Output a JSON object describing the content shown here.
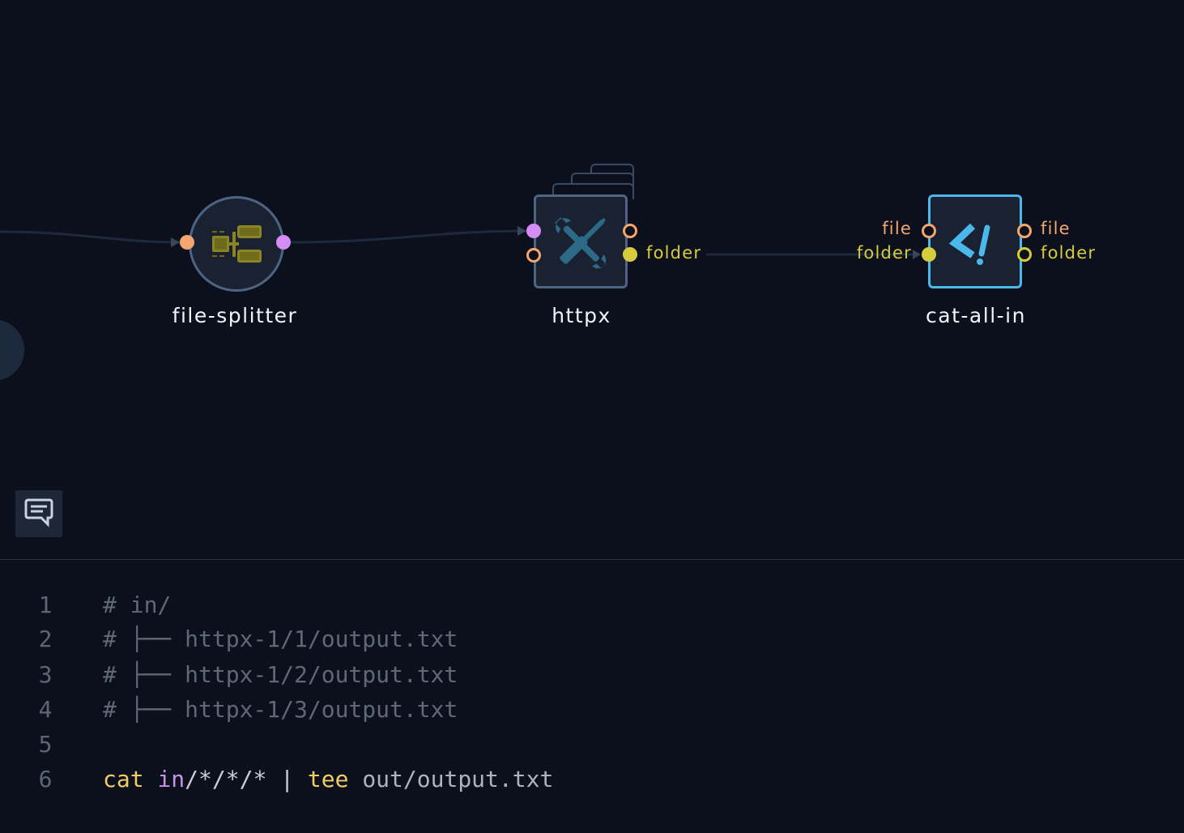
{
  "canvas": {
    "nodes": [
      {
        "id": "file-splitter",
        "label": "file-splitter",
        "shape": "circle",
        "icon": "file-splitter-icon"
      },
      {
        "id": "httpx",
        "label": "httpx",
        "shape": "stacked-box",
        "icon": "tools-icon",
        "ports": {
          "right": [
            {
              "label": "",
              "style": "ring-orange"
            },
            {
              "label": "folder",
              "style": "filled-yellow"
            }
          ]
        }
      },
      {
        "id": "cat-all-in",
        "label": "cat-all-in",
        "shape": "box",
        "selected": true,
        "icon": "script-icon",
        "ports": {
          "left": [
            {
              "label": "file",
              "style": "ring-orange"
            },
            {
              "label": "folder",
              "style": "filled-yellow"
            }
          ],
          "right": [
            {
              "label": "file",
              "style": "ring-orange"
            },
            {
              "label": "folder",
              "style": "ring-yellow"
            }
          ]
        }
      }
    ],
    "comment_button_icon": "comment-icon"
  },
  "colors": {
    "background": "#0b101c",
    "node_fill": "#1a2232",
    "node_border": "#4d6483",
    "selected_border": "#4bb7ea",
    "port_orange": "#f3a76e",
    "port_purple": "#d58cf4",
    "port_yellow": "#d6cc3d"
  },
  "editor": {
    "lines": [
      {
        "num": "1",
        "tokens": [
          {
            "t": "# in/",
            "c": "comment"
          }
        ]
      },
      {
        "num": "2",
        "tokens": [
          {
            "t": "# ├── httpx-1/1/output.txt",
            "c": "comment"
          }
        ]
      },
      {
        "num": "3",
        "tokens": [
          {
            "t": "# ├── httpx-1/2/output.txt",
            "c": "comment"
          }
        ]
      },
      {
        "num": "4",
        "tokens": [
          {
            "t": "# ├── httpx-1/3/output.txt",
            "c": "comment"
          }
        ]
      },
      {
        "num": "5",
        "tokens": []
      },
      {
        "num": "6",
        "tokens": [
          {
            "t": "cat",
            "c": "keyword"
          },
          {
            "t": " ",
            "c": "plain"
          },
          {
            "t": "in",
            "c": "path"
          },
          {
            "t": "/*/*/*",
            "c": "plain"
          },
          {
            "t": " | ",
            "c": "plain"
          },
          {
            "t": "tee",
            "c": "keyword"
          },
          {
            "t": " out/output.txt",
            "c": "dim"
          }
        ]
      }
    ]
  }
}
